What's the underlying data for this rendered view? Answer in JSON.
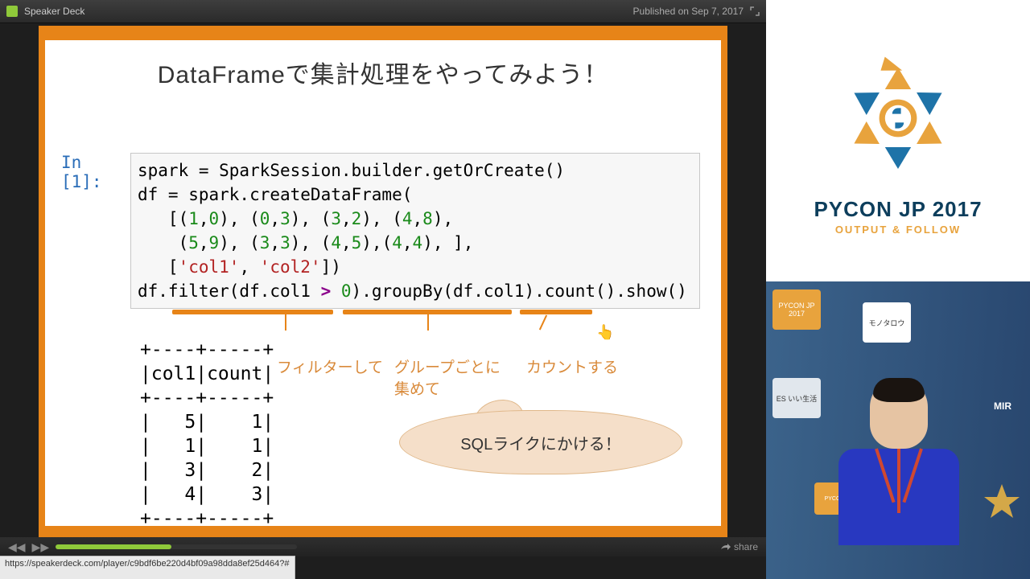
{
  "titlebar": {
    "site": "Speaker Deck",
    "published": "Published on Sep 7, 2017"
  },
  "slide": {
    "title": "DataFrameで集計処理をやってみよう！",
    "in_prompt": "In [1]:",
    "code_line1a": "spark = SparkSession.builder.getOrCreate()",
    "code_line2a": "df = spark.createDataFrame(",
    "code_tuples1": "   [(1,0), (0,3), (3,2), (4,8),",
    "code_tuples2": "    (5,9), (3,3), (4,5),(4,4), ],",
    "code_cols": "   ['col1', 'col2'])",
    "code_filter": "df.filter(df.col1 > 0).groupBy(df.col1).count().show()",
    "annot_filter": "フィルターして",
    "annot_group": "グループごとに集めて",
    "annot_count": "カウントする",
    "bubble": "SQLライクにかける！",
    "output_header_sep": "+----+-----+",
    "output_header": "|col1|count|",
    "output_rows": [
      "|   5|    1|",
      "|   1|    1|",
      "|   3|    2|",
      "|   4|    3|"
    ]
  },
  "controls": {
    "share": "share"
  },
  "url": "https://speakerdeck.com/player/c9bdf6be220d4bf09a98dda8ef25d464?#",
  "conf": {
    "title": "PYCON JP 2017",
    "subtitle": "OUTPUT & FOLLOW"
  },
  "sponsors": {
    "s1": "PYCON JP 2017",
    "s2": "モノタロウ",
    "s3": "ES いい生活",
    "s4": "MIR"
  }
}
